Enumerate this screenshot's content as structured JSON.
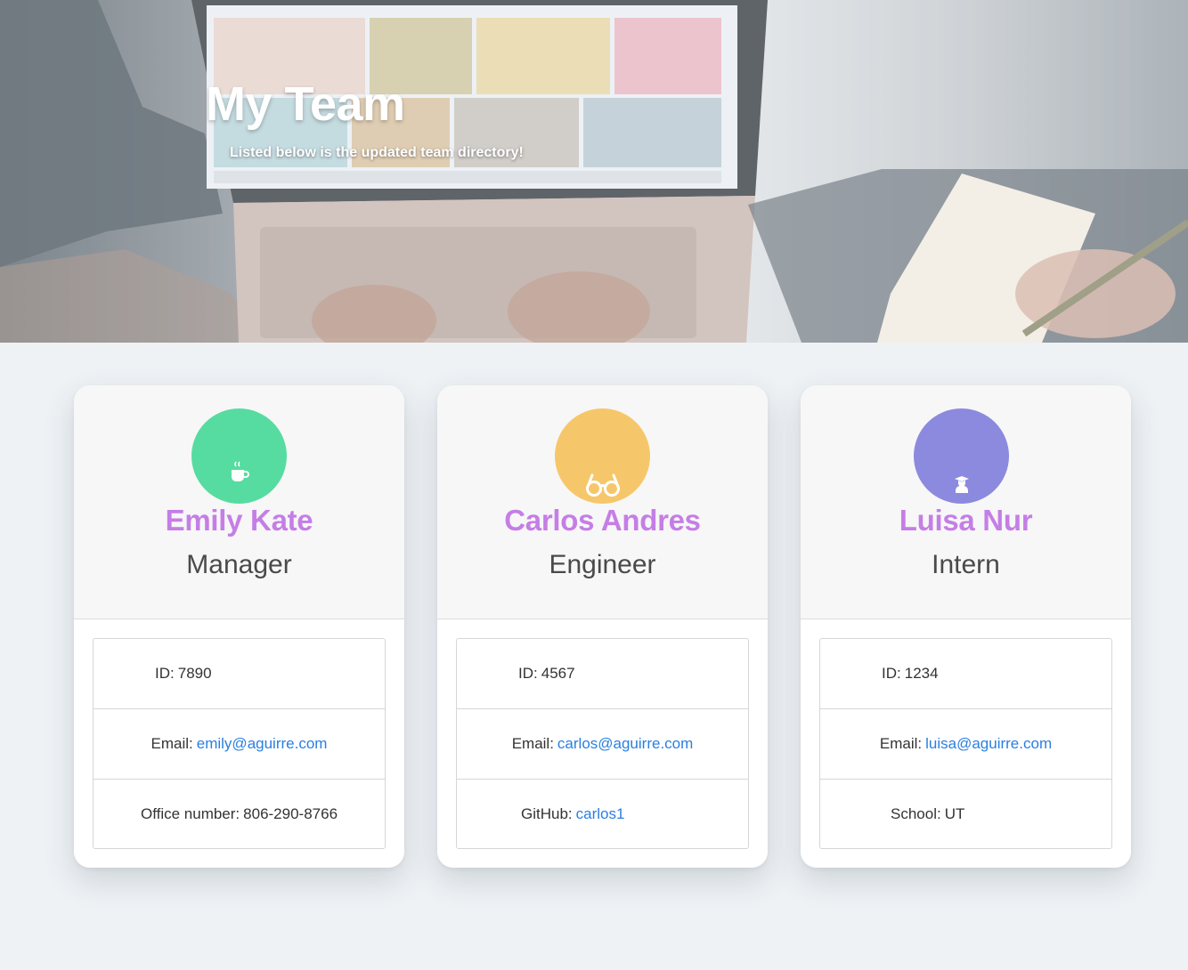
{
  "hero": {
    "title": "My Team",
    "subtitle": "Listed below is the updated team directory!"
  },
  "colors": {
    "name": "#c57ee6",
    "link": "#2a7fe0",
    "manager_avatar": "#56dca0",
    "engineer_avatar": "#f6c76a",
    "intern_avatar": "#8c8ade"
  },
  "cards": [
    {
      "name": "Emily Kate",
      "role": "Manager",
      "icon": "coffee-cup-icon",
      "id_label": "ID:",
      "id_value": "7890",
      "email_label": "Email:",
      "email": "emily@aguirre.com",
      "extra_label": "Office number:",
      "extra_value": "806-290-8766"
    },
    {
      "name": "Carlos Andres",
      "role": "Engineer",
      "icon": "glasses-icon",
      "id_label": "ID:",
      "id_value": "4567",
      "email_label": "Email:",
      "email": "carlos@aguirre.com",
      "extra_label": "GitHub:",
      "extra_value": "carlos1"
    },
    {
      "name": "Luisa Nur",
      "role": "Intern",
      "icon": "graduate-icon",
      "id_label": "ID:",
      "id_value": "1234",
      "email_label": "Email:",
      "email": "luisa@aguirre.com",
      "extra_label": "School:",
      "extra_value": "UT"
    }
  ]
}
